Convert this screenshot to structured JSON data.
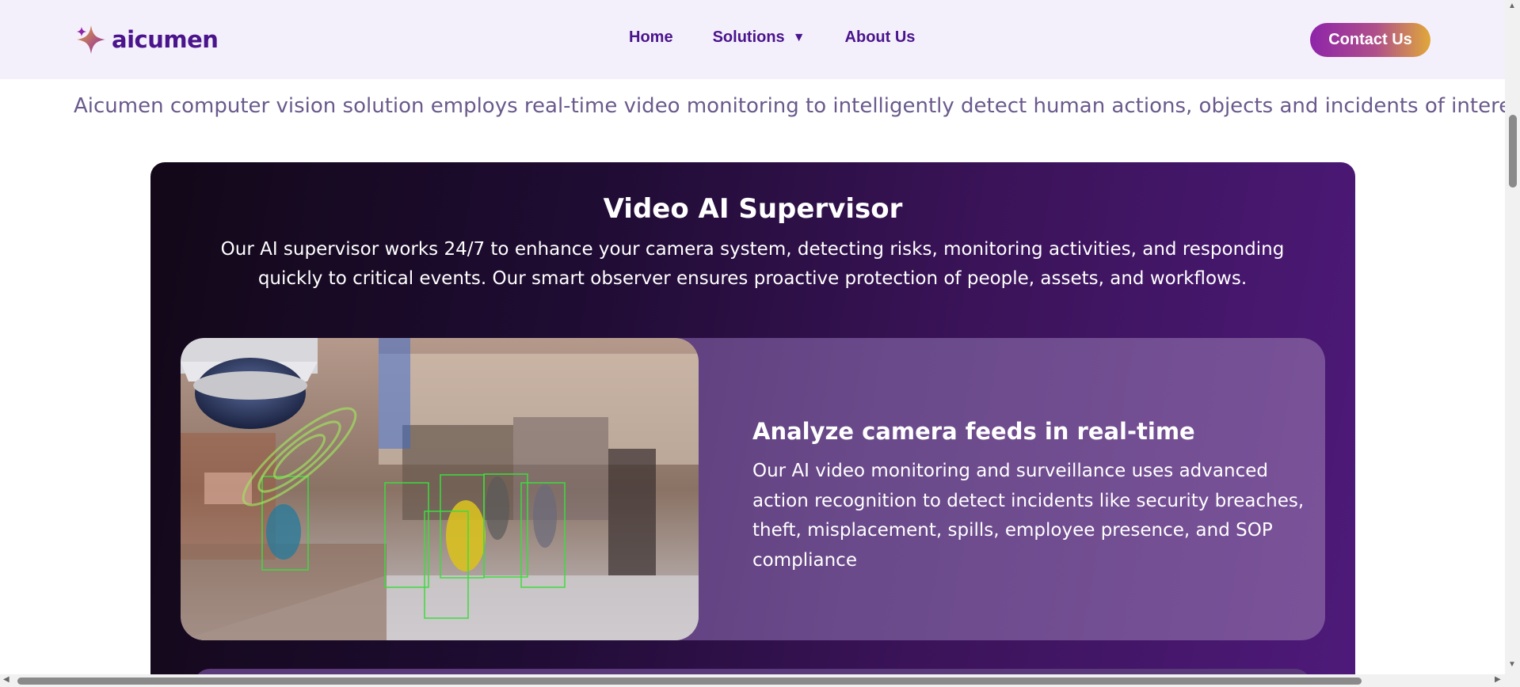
{
  "header": {
    "logo_text": "aicumen",
    "nav": [
      {
        "label": "Home"
      },
      {
        "label": "Solutions"
      },
      {
        "label": "About Us"
      }
    ],
    "contact_label": "Contact Us"
  },
  "intro_text": "Aicumen computer vision solution employs real-time video monitoring to intelligently detect human actions, objects and incidents of interest.",
  "card": {
    "title": "Video AI Supervisor",
    "description": "Our AI supervisor works 24/7 to enhance your camera system, detecting risks, monitoring activities, and responding quickly to critical events. Our smart observer ensures proactive protection of people, assets, and workflows.",
    "feature": {
      "title": "Analyze camera feeds in real-time",
      "text": "Our AI video monitoring and surveillance uses advanced action recognition to detect incidents like security breaches, theft, misplacement, spills, employee presence, and SOP compliance"
    }
  },
  "colors": {
    "brand_purple": "#4a148c",
    "header_bg": "#f4f0fb",
    "accent_gold": "#e0a83a",
    "detection_box": "#3ddc3d"
  },
  "icons": {
    "logo": "sparkle-star-icon",
    "solutions_dropdown": "caret-down-icon"
  }
}
